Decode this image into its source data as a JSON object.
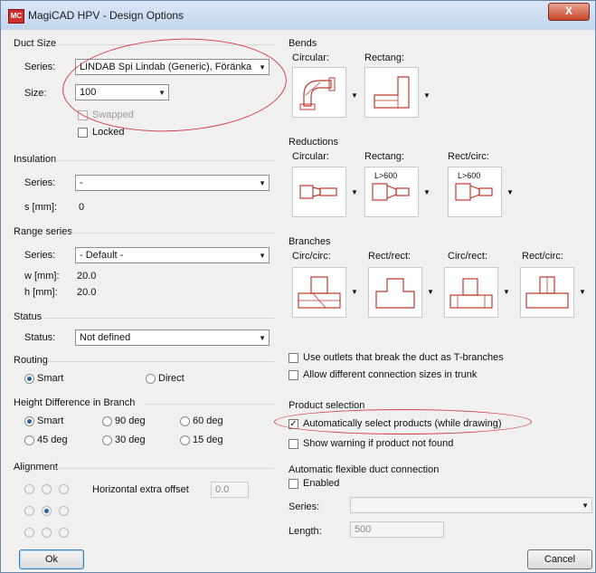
{
  "window": {
    "title": "MagiCAD HPV - Design Options",
    "close_glyph": "X"
  },
  "duct_size": {
    "heading": "Duct Size",
    "series_label": "Series:",
    "series_value": "LINDAB Spi Lindab (Generic), Föränka",
    "size_label": "Size:",
    "size_value": "100",
    "swapped_label": "Swapped",
    "locked_label": "Locked"
  },
  "insulation": {
    "heading": "Insulation",
    "series_label": "Series:",
    "series_value": "-",
    "s_label": "s [mm]:",
    "s_value": "0"
  },
  "range_series": {
    "heading": "Range series",
    "series_label": "Series:",
    "series_value": "- Default -",
    "w_label": "w [mm]:",
    "w_value": "20.0",
    "h_label": "h [mm]:",
    "h_value": "20.0"
  },
  "status": {
    "heading": "Status",
    "label": "Status:",
    "value": "Not defined"
  },
  "routing": {
    "heading": "Routing",
    "smart": "Smart",
    "direct": "Direct"
  },
  "height_diff": {
    "heading": "Height Difference in Branch",
    "smart": "Smart",
    "d90": "90 deg",
    "d60": "60 deg",
    "d45": "45 deg",
    "d30": "30 deg",
    "d15": "15 deg"
  },
  "alignment": {
    "heading": "Alignment",
    "offset_label": "Horizontal extra offset",
    "offset_value": "0.0"
  },
  "bends": {
    "heading": "Bends",
    "circular": "Circular:",
    "rectang": "Rectang:"
  },
  "reductions": {
    "heading": "Reductions",
    "circular": "Circular:",
    "rectang": "Rectang:",
    "rectcirc": "Rect/circ:",
    "rect_tag1": "L>600",
    "rect_tag2": "L>600"
  },
  "branches": {
    "heading": "Branches",
    "circcirc": "Circ/circ:",
    "rectrect": "Rect/rect:",
    "circrect": "Circ/rect:",
    "rectcirc": "Rect/circ:"
  },
  "options": {
    "outlets": "Use outlets that break the duct as T-branches",
    "allow_sizes": "Allow different connection sizes in trunk"
  },
  "product_selection": {
    "heading": "Product selection",
    "auto_select": "Automatically select products (while drawing)",
    "warning": "Show warning if product not found"
  },
  "flex": {
    "heading": "Automatic flexible duct connection",
    "enabled": "Enabled",
    "series_label": "Series:",
    "length_label": "Length:",
    "length_value": "500"
  },
  "buttons": {
    "ok": "Ok",
    "cancel": "Cancel"
  },
  "colors": {
    "annotation": "#d8434a",
    "fitting": "#c0392b"
  }
}
